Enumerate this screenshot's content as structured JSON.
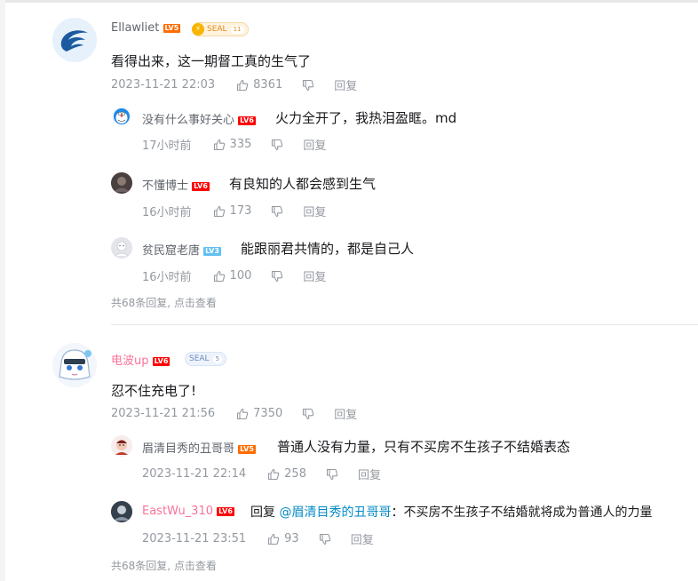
{
  "comments": [
    {
      "username": "Ellawliet",
      "level": "LV5",
      "seal_label": "SEAL",
      "seal_count": "11",
      "content": "看得出来，这一期督工真的生气了",
      "time": "2023-11-21 22:03",
      "likes": "8361",
      "reply_label": "回复",
      "replies": [
        {
          "username": "没有什么事好关心",
          "level": "LV6",
          "content": "火力全开了，我热泪盈眶。md",
          "time": "17小时前",
          "likes": "335",
          "reply_label": "回复"
        },
        {
          "username": "不懂博士",
          "level": "LV6",
          "content": "有良知的人都会感到生气",
          "time": "16小时前",
          "likes": "173",
          "reply_label": "回复"
        },
        {
          "username": "贫民窟老唐",
          "level": "LV3",
          "content": "能跟丽君共情的，都是自己人",
          "time": "16小时前",
          "likes": "100",
          "reply_label": "回复"
        }
      ],
      "more_replies": "共68条回复, 点击查看"
    },
    {
      "username": "电波up",
      "level": "LV6",
      "seal_label": "SEAL",
      "seal_count": "5",
      "content": "忍不住充电了!",
      "time": "2023-11-21 21:56",
      "likes": "7350",
      "reply_label": "回复",
      "replies": [
        {
          "username": "眉清目秀的丑哥哥",
          "level": "LV5",
          "content": "普通人没有力量，只有不买房不生孩子不结婚表态",
          "time": "2023-11-21 22:14",
          "likes": "258",
          "reply_label": "回复"
        },
        {
          "username": "EastWu_310",
          "level": "LV6",
          "reply_prefix": "回复",
          "mention": "@眉清目秀的丑哥哥",
          "content": "：不买房不生孩子不结婚就将成为普通人的力量",
          "time": "2023-11-21 23:51",
          "likes": "93",
          "reply_label": "回复"
        }
      ],
      "more_replies": "共68条回复, 点击查看"
    }
  ],
  "colors": {
    "username_pink": "#fb7299",
    "meta_gray": "#9499a0",
    "mention_blue": "#008ac5",
    "lv5": "#ff6c00",
    "lv6": "#ff0000",
    "lv3": "#61c0f1"
  }
}
